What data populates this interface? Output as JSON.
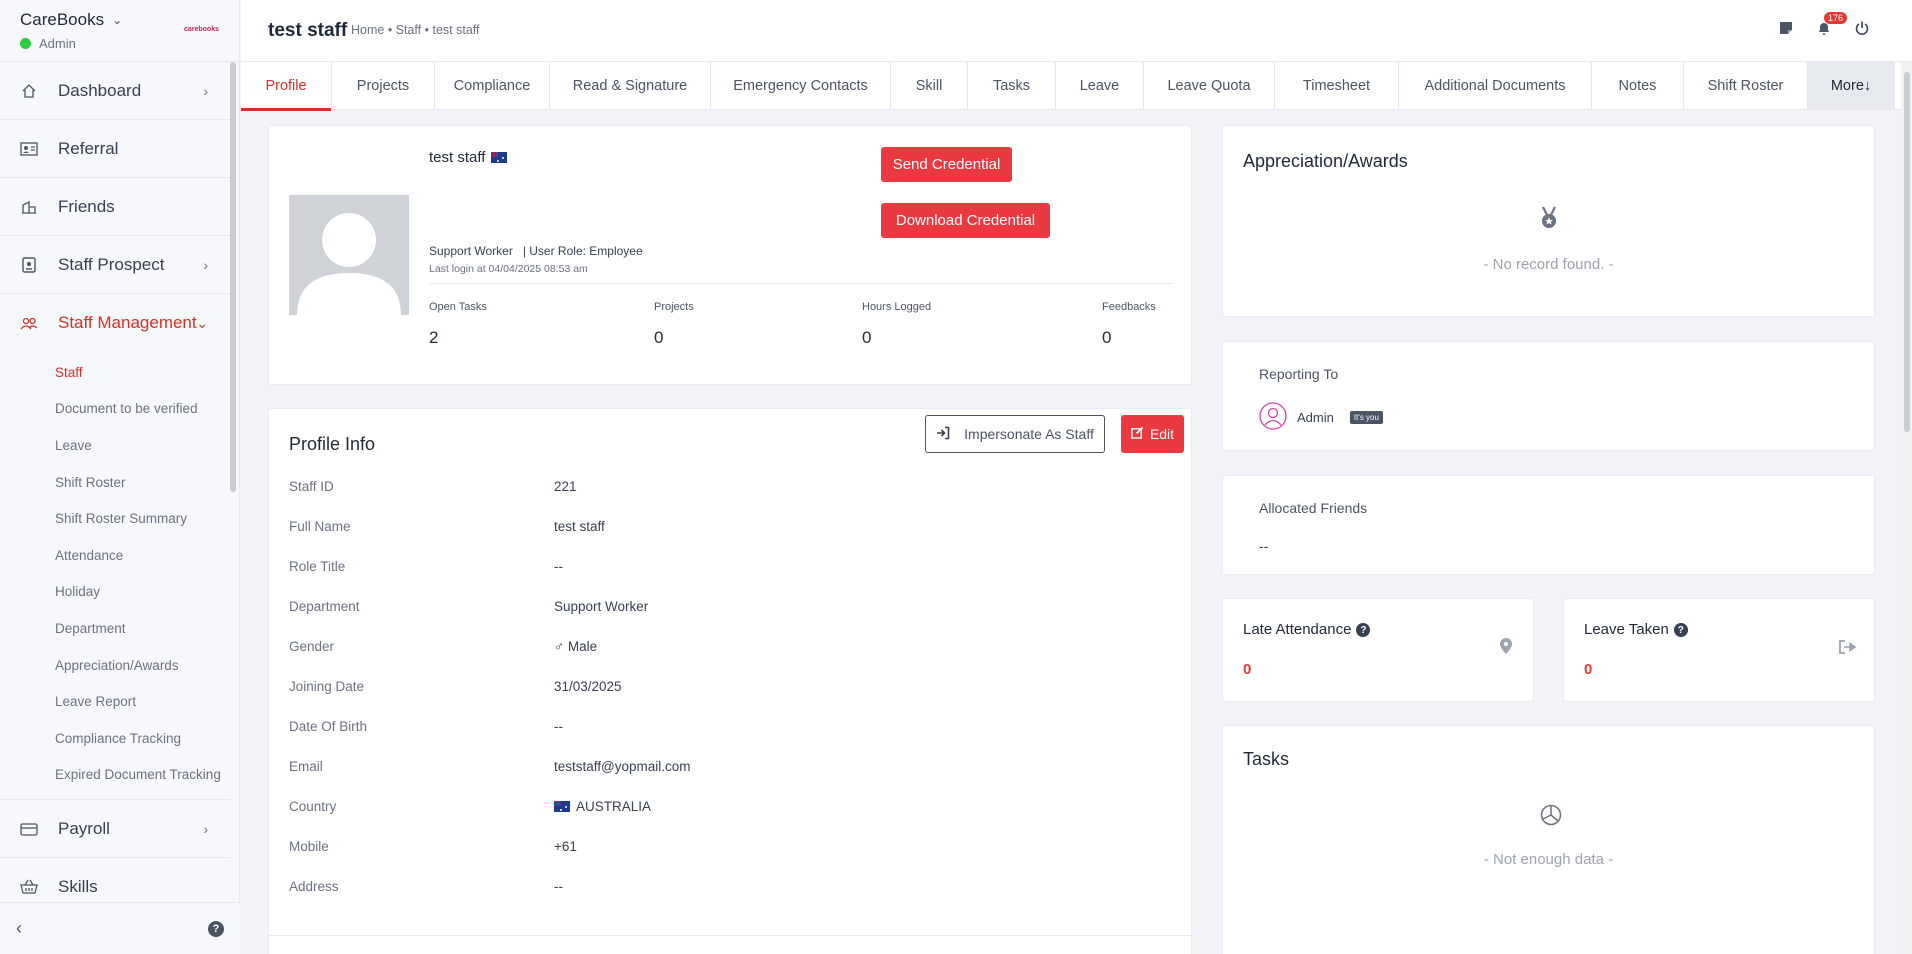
{
  "app": {
    "name": "CareBooks",
    "role": "Admin",
    "logo_text": "carebooks"
  },
  "sidebar": {
    "items": [
      {
        "label": "Dashboard"
      },
      {
        "label": "Referral"
      },
      {
        "label": "Friends"
      },
      {
        "label": "Staff Prospect"
      },
      {
        "label": "Staff Management"
      },
      {
        "label": "Payroll"
      },
      {
        "label": "Skills"
      }
    ],
    "sub_items": [
      "Staff",
      "Document to be verified",
      "Leave",
      "Shift Roster",
      "Shift Roster Summary",
      "Attendance",
      "Holiday",
      "Department",
      "Appreciation/Awards",
      "Leave Report",
      "Compliance Tracking",
      "Expired Document Tracking"
    ]
  },
  "header": {
    "title": "test staff",
    "breadcrumb": "Home • Staff • test staff",
    "notification_count": "176"
  },
  "tabs": [
    "Profile",
    "Projects",
    "Compliance",
    "Read & Signature",
    "Emergency Contacts",
    "Skill",
    "Tasks",
    "Leave",
    "Leave Quota",
    "Timesheet",
    "Additional Documents",
    "Notes",
    "Shift Roster",
    "More↓"
  ],
  "profile": {
    "name": "test staff",
    "send_credential": "Send Credential",
    "download_credential": "Download Credential",
    "meta": "Support Worker   | User Role: Employee",
    "last_login": "Last login at 04/04/2025 08:53 am",
    "stats": [
      {
        "label": "Open Tasks",
        "value": "2"
      },
      {
        "label": "Projects",
        "value": "0"
      },
      {
        "label": "Hours Logged",
        "value": "0"
      },
      {
        "label": "Feedbacks",
        "value": "0"
      }
    ]
  },
  "profile_info": {
    "title": "Profile Info",
    "impersonate": "Impersonate As Staff",
    "edit": "Edit",
    "rows": [
      {
        "label": "Staff ID",
        "value": "221"
      },
      {
        "label": "Full Name",
        "value": "test staff"
      },
      {
        "label": "Role Title",
        "value": "--"
      },
      {
        "label": "Department",
        "value": "Support Worker"
      },
      {
        "label": "Gender",
        "value": "♂ Male"
      },
      {
        "label": "Joining Date",
        "value": "31/03/2025"
      },
      {
        "label": "Date Of Birth",
        "value": "--"
      },
      {
        "label": "Email",
        "value": "teststaff@yopmail.com"
      },
      {
        "label": "Country",
        "value": "AUSTRALIA"
      },
      {
        "label": "Mobile",
        "value": "+61"
      },
      {
        "label": "Address",
        "value": "--"
      }
    ]
  },
  "awards": {
    "title": "Appreciation/Awards",
    "empty": "- No record found. -"
  },
  "reporting": {
    "title": "Reporting To",
    "name": "Admin",
    "badge": "It's you"
  },
  "friends": {
    "title": "Allocated Friends",
    "value": "--"
  },
  "late_attendance": {
    "title": "Late Attendance",
    "value": "0"
  },
  "leave_taken": {
    "title": "Leave Taken",
    "value": "0"
  },
  "tasks": {
    "title": "Tasks",
    "empty": "- Not enough data -"
  },
  "colors": {
    "accent": "#ea3940",
    "online": "#2ecc40"
  }
}
